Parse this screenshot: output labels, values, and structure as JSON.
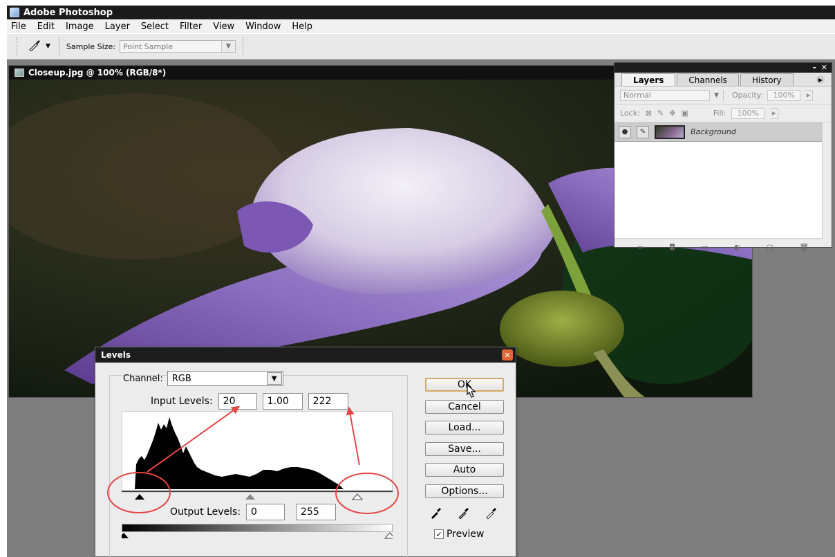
{
  "app": {
    "title": "Adobe Photoshop"
  },
  "menu": [
    "File",
    "Edit",
    "Image",
    "Layer",
    "Select",
    "Filter",
    "View",
    "Window",
    "Help"
  ],
  "options_bar": {
    "sample_size_label": "Sample Size:",
    "sample_size_value": "Point Sample"
  },
  "document": {
    "title": "Closeup.jpg @ 100% (RGB/8*)"
  },
  "layers_panel": {
    "tabs": [
      "Layers",
      "Channels",
      "History"
    ],
    "active_tab": "Layers",
    "blend_mode": "Normal",
    "opacity_label": "Opacity:",
    "opacity_value": "100%",
    "lock_label": "Lock:",
    "fill_label": "Fill:",
    "fill_value": "100%",
    "layer_name": "Background"
  },
  "levels_dialog": {
    "title": "Levels",
    "channel_label": "Channel:",
    "channel_value": "RGB",
    "input_levels_label": "Input Levels:",
    "input_black": "20",
    "input_gamma": "1.00",
    "input_white": "222",
    "output_levels_label": "Output Levels:",
    "output_black": "0",
    "output_white": "255",
    "buttons": {
      "ok": "OK",
      "cancel": "Cancel",
      "load": "Load...",
      "save": "Save...",
      "auto": "Auto",
      "options": "Options..."
    },
    "preview_label": "Preview",
    "preview_checked": true
  },
  "colors": {
    "annotation_red": "#e64646",
    "ok_border": "#d7a865",
    "close_orange": "#e26737"
  },
  "icons": [
    "eyedropper-tool-icon",
    "eye-icon",
    "brush-icon",
    "lock-icon",
    "eyedropper-black-icon",
    "eyedropper-gray-icon",
    "eyedropper-white-icon",
    "cursor-icon"
  ]
}
